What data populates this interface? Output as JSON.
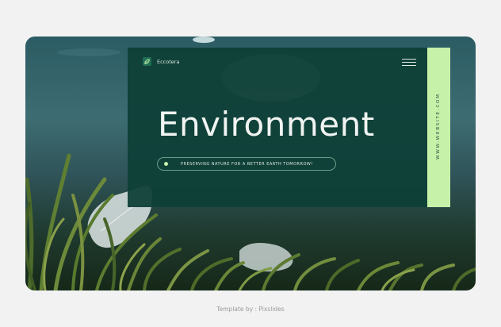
{
  "header": {
    "brand_name": "Eccotera",
    "logo_icon": "leaf-icon",
    "menu_icon": "hamburger-menu-icon"
  },
  "hero": {
    "title": "Environment",
    "tagline": "PRESERVING NATURE FOR A BETTER EARTH TOMORROW!"
  },
  "side_strip": {
    "website": "WWW.WEBSITE.COM"
  },
  "footer": {
    "credit": "Template by : Pixslides"
  },
  "colors": {
    "card": "#0e4037",
    "accent": "#c6f1a9",
    "page_background": "#f2f2f2"
  }
}
